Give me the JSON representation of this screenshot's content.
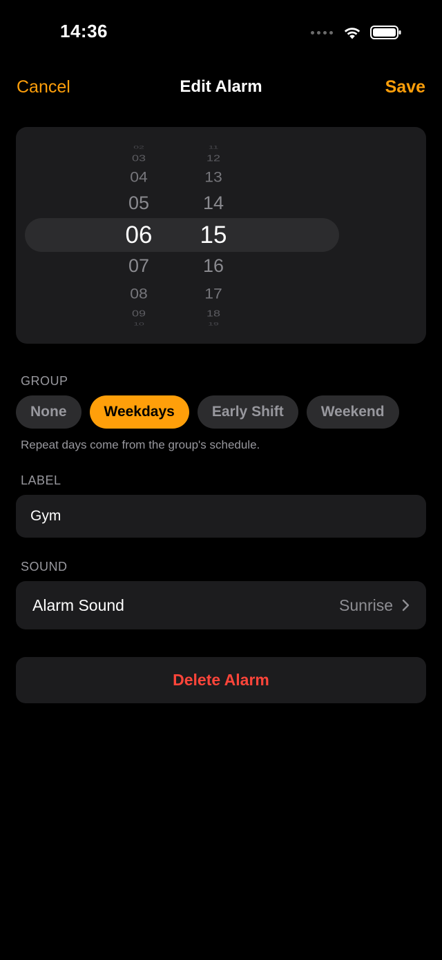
{
  "status_bar": {
    "time": "14:36"
  },
  "nav": {
    "cancel_label": "Cancel",
    "title": "Edit Alarm",
    "save_label": "Save"
  },
  "picker": {
    "hours": [
      "03",
      "04",
      "05",
      "06",
      "07",
      "08",
      "09"
    ],
    "selected_hour": "06",
    "minutes": [
      "12",
      "13",
      "14",
      "15",
      "16",
      "17",
      "18"
    ],
    "selected_minute": "15"
  },
  "group": {
    "header": "GROUP",
    "options": [
      "None",
      "Weekdays",
      "Early Shift",
      "Weekend"
    ],
    "selected": "Weekdays",
    "note": "Repeat days come from the group's schedule."
  },
  "label": {
    "header": "LABEL",
    "value": "Gym"
  },
  "sound": {
    "header": "SOUND",
    "title": "Alarm Sound",
    "value": "Sunrise"
  },
  "delete_label": "Delete Alarm",
  "colors": {
    "accent": "#ff9f0a",
    "destructive": "#ff453a",
    "background": "#000000",
    "card": "#1c1c1e"
  },
  "icons": [
    "signal-dots-icon",
    "wifi-icon",
    "battery-icon",
    "chevron-right-icon"
  ]
}
